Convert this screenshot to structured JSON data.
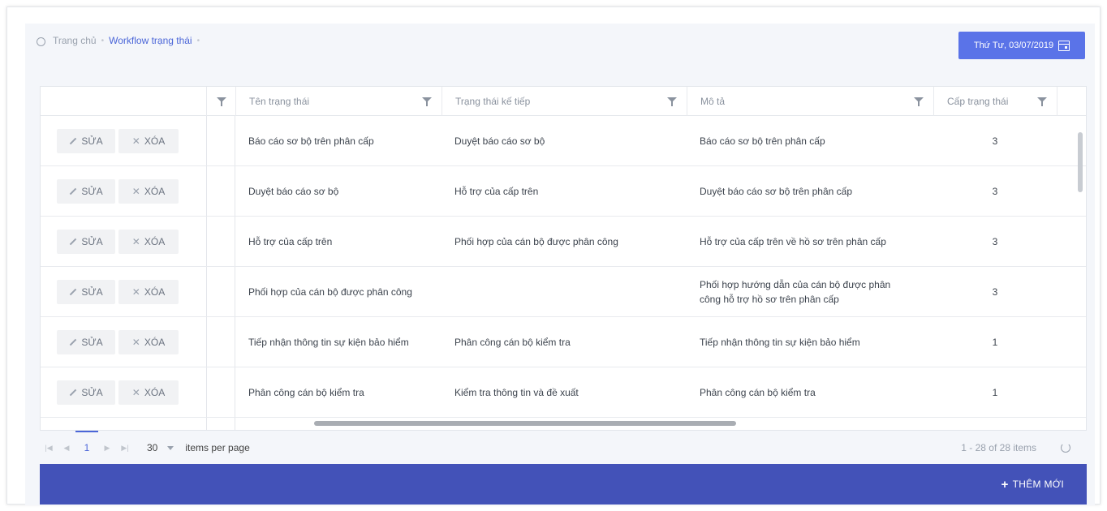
{
  "breadcrumb": {
    "home": "Trang chủ",
    "current": "Workflow trạng thái",
    "separator": "•"
  },
  "date_button": {
    "label": "Thứ Tư, 03/07/2019",
    "icon": "calendar-icon"
  },
  "columns": [
    {
      "label": ""
    },
    {
      "label": "Tên trạng thái"
    },
    {
      "label": "Trạng thái kế tiếp"
    },
    {
      "label": "Mô tả"
    },
    {
      "label": "Cấp trạng thái"
    }
  ],
  "actions": {
    "edit_label": "SỬA",
    "delete_label": "XÓA"
  },
  "rows": [
    {
      "name": "Báo cáo sơ bộ trên phân cấp",
      "next": "Duyệt báo cáo sơ bộ",
      "desc": "Báo cáo sơ bộ trên phân cấp",
      "level": "3"
    },
    {
      "name": "Duyệt báo cáo sơ bộ",
      "next": "Hỗ trợ của cấp trên",
      "desc": "Duyệt báo cáo sơ bộ trên phân cấp",
      "level": "3"
    },
    {
      "name": "Hỗ trợ của cấp trên",
      "next": "Phối hợp của cán bộ được phân công",
      "desc": "Hỗ trợ của cấp trên về hồ sơ trên phân cấp",
      "level": "3"
    },
    {
      "name": "Phối hợp của cán bộ được phân công",
      "next": "",
      "desc": "Phối hợp hướng dẫn của cán bộ được phân công hỗ trợ hồ sơ trên phân cấp",
      "level": "3"
    },
    {
      "name": "Tiếp nhận thông tin sự kiện bảo hiểm",
      "next": "Phân công cán bộ kiểm tra",
      "desc": "Tiếp nhận thông tin sự kiện bảo hiểm",
      "level": "1"
    },
    {
      "name": "Phân công cán bộ kiểm tra",
      "next": "Kiểm tra thông tin và đề xuất",
      "desc": "Phân công cán bộ kiểm tra",
      "level": "1"
    }
  ],
  "pager": {
    "current_page": "1",
    "page_size": "30",
    "per_page_label": "items per page",
    "info": "1 - 28 of 28 items"
  },
  "footer": {
    "add_label": "THÊM MỚI"
  },
  "colors": {
    "accent": "#5a73e8",
    "footer": "#4352b8",
    "link": "#4b66d8"
  }
}
